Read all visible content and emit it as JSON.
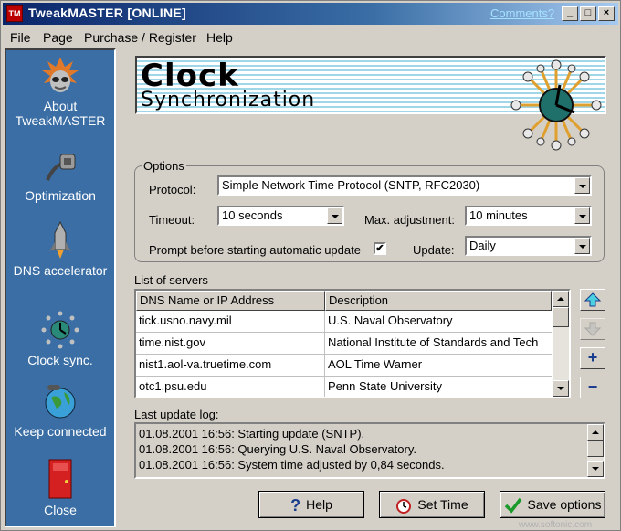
{
  "window": {
    "title": "TweakMASTER [ONLINE]",
    "comments_link": "Comments?",
    "controls": {
      "minimize": "_",
      "maximize": "□",
      "close": "×"
    }
  },
  "menu": [
    "File",
    "Page",
    "Purchase / Register",
    "Help"
  ],
  "sidebar": {
    "items": [
      {
        "label": "About TweakMASTER",
        "icon": "logo-face-icon"
      },
      {
        "label": "Optimization",
        "icon": "cable-plug-icon"
      },
      {
        "label": "DNS accelerator",
        "icon": "rocket-icon"
      },
      {
        "label": "Clock sync.",
        "icon": "clock-icon"
      },
      {
        "label": "Keep connected",
        "icon": "globe-phone-icon"
      },
      {
        "label": "Close",
        "icon": "door-icon"
      }
    ]
  },
  "header": {
    "line1": "Clock",
    "line2": "Synchronization"
  },
  "options": {
    "legend": "Options",
    "protocol_label": "Protocol:",
    "protocol_value": "Simple Network Time Protocol (SNTP, RFC2030)",
    "timeout_label": "Timeout:",
    "timeout_value": "10 seconds",
    "max_adj_label": "Max. adjustment:",
    "max_adj_value": "10 minutes",
    "prompt_label": "Prompt before starting automatic update",
    "prompt_checked": "✔",
    "update_label": "Update:",
    "update_value": "Daily"
  },
  "servers": {
    "label": "List of servers",
    "columns": [
      "DNS Name or IP Address",
      "Description"
    ],
    "rows": [
      [
        "tick.usno.navy.mil",
        "U.S. Naval Observatory"
      ],
      [
        "time.nist.gov",
        "National Institute of Standards and Tech"
      ],
      [
        "nist1.aol-va.truetime.com",
        "AOL Time Warner"
      ],
      [
        "otc1.psu.edu",
        "Penn State University"
      ]
    ]
  },
  "log": {
    "label": "Last update log:",
    "lines": [
      "01.08.2001 16:56: Starting update (SNTP).",
      "01.08.2001 16:56: Querying U.S. Naval Observatory.",
      "01.08.2001 16:56: System time adjusted by 0,84 seconds."
    ]
  },
  "buttons": {
    "help": "Help",
    "set_time": "Set Time",
    "save": "Save options"
  },
  "watermark": "www.softonic.com",
  "colors": {
    "sidebar": "#3a6ea5",
    "titlebar": "#0a246a",
    "accent": "#1a3c8c"
  }
}
